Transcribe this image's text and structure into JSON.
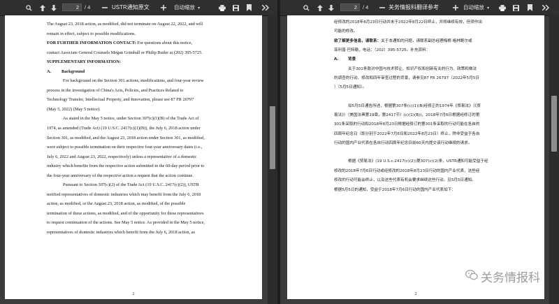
{
  "left": {
    "toolbar": {
      "page_current": "2",
      "page_total": "/ 4",
      "doc_title": "USTR通知原文",
      "zoom": "自动缩放"
    },
    "page": {
      "lines": [
        "The August 23, 2018 action, as modified, did not terminate on August 22, 2022, and will",
        "remain in effect, subject to possible modifications."
      ],
      "contact_label": "FOR FURTHER INFORMATION CONTACT:",
      "contact_rest": " For questions about this notice,",
      "contact_line2": "contact Associate General Counsels Megan Grimball or Philip Butler at (202) 395-5725.",
      "supp": "SUPPLEMENTARY INFORMATION:",
      "section_a": "A.",
      "section_title": "Background",
      "para1": [
        "For background on the Section 301 actions, modifications, and four-year review",
        "process in the investigation of China's Acts, Policies, and Practices Related to",
        "Technology Transfer, Intellectual Property, and Innovation, please see 87 FR 26797",
        "(May 5, 2022) (May 5 notice)."
      ],
      "para2": [
        "As stated in the May 5 notice, under Section 307(c)(1)(B) of the Trade Act of",
        "1974, as amended (Trade Act) (19 U.S.C. 2417(c)(1)(B)), the July 6, 2018 action under",
        "Section 301, as modified, and the August 23, 2018 action under Section 301, as modified,",
        "were subject to possible termination on their respective four-year anniversary dates (i.e.,",
        "July 6, 2022 and August 23, 2022, respectively) unless a representative of a domestic",
        "industry which benefits from the respective action submitted in the 60-day period prior to",
        "the four-year anniversary of the respective action a request that the action continue."
      ],
      "para3": [
        "Pursuant to Section 307(c)(2) of the Trade Act (19 U.S.C. 2417(c)(2)), USTR",
        "notified representatives of domestic industries which may benefit from the July 6, 2018",
        "action, as modified, or the August 23, 2018 action, as modified, of the possible",
        "termination of these actions, as modified, and of the opportunity for these representatives",
        "to request continuation of the actions. See May 5 notice. As provided in the May 5 notice,",
        "representatives of domestic industries which benefit from the July 6, 2018 action, as"
      ],
      "page_number": "2"
    }
  },
  "right": {
    "toolbar": {
      "page_current": "2",
      "page_total": "/ 4",
      "doc_title": "关务情报科翻译参考",
      "zoom": "自动缩放"
    },
    "page": {
      "intro": [
        "经修改的2018年8月23日行动并未于2022年8月22日终止，并将继续有效，但须作出",
        "可能的修改。"
      ],
      "contact_label": "欲了解更多信息，请联系：",
      "contact_rest": "关于本通知的问题，请联系副总经理梅根·格林鲍尔或",
      "contact_line2": "菲利普·巴特勒，电话：（202）395-5725。补充资料：",
      "section_a": "A.",
      "section_title": "背景",
      "para1": [
        "关于301条款对中国与技术转让、知识产权和创新有关的行为、政策和做法",
        "的调查的行动、修改和四年审查过程的背景，请参见87 FR 26797（2022年5月5日",
        "）（5月5日通知）。"
      ],
      "para2": [
        "如5月5日通告所述，根据第307条(c)(1)(B)经修正的1974年《贸易法》（《贸",
        "易法》）（美国法典第19章，第2417节）(c)(1)(B))，2018年7月6日根据经修订的第",
        "301条采取的行动和2018年8月23日根据经修订的第301条采取的行动可能在各自的",
        "四周年纪念日（即分别于2022年7月6日和2022年8月23日）终止，除非受益于各自",
        "行动的国内产业代表在各自行动四周年纪念日前60天内提交该行动继续的请求。"
      ],
      "para3": [
        "根据《贸易法》(19 U.S.c.2417(c)(2))第307(c)(2)条，USTR通知可能受益于经",
        "修改的2018年7月6日行动或经修改的2018年8月23日行动的国内产业代表，这些经",
        "修改的行动可能会终止，以及这些代表有机会要求继续这些行动。见5月5日通知。",
        "根据5月5日的通知，受益于2018年7月6日行动的国内产业代表如下："
      ],
      "page_number": "2"
    },
    "watermark": "关务情报科"
  },
  "colors": {
    "toolbar": "#2f2f2f",
    "viewer_bg": "#3c3c3c",
    "scroll_thumb": "#8e8e8e",
    "page": "#ffffff"
  },
  "icons": [
    "search-icon",
    "arrow-up-icon",
    "arrow-down-icon",
    "minus-icon",
    "plus-icon",
    "print-icon",
    "save-icon",
    "bookmark-icon",
    "double-chevron-right-icon"
  ]
}
